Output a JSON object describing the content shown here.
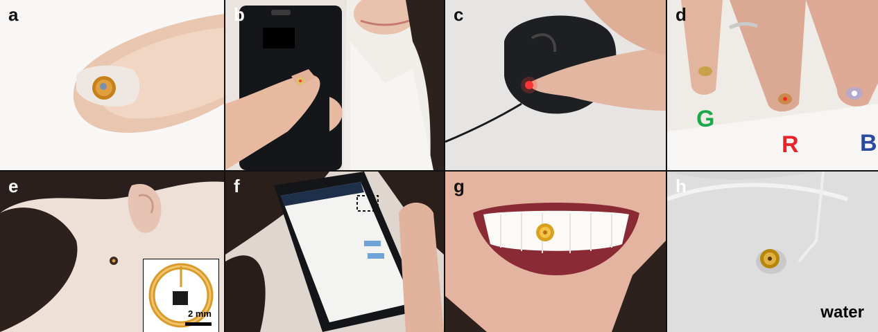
{
  "panels": [
    {
      "id": "a",
      "label": "a"
    },
    {
      "id": "b",
      "label": "b"
    },
    {
      "id": "c",
      "label": "c"
    },
    {
      "id": "d",
      "label": "d",
      "colors": {
        "G": "G",
        "R": "R",
        "B": "B"
      }
    },
    {
      "id": "e",
      "label": "e",
      "scale": "2 mm"
    },
    {
      "id": "f",
      "label": "f"
    },
    {
      "id": "g",
      "label": "g"
    },
    {
      "id": "h",
      "label": "h",
      "caption": "water"
    }
  ],
  "colors": {
    "green": "#1aa84a",
    "red": "#e8232a",
    "blue": "#2a4aa0"
  }
}
